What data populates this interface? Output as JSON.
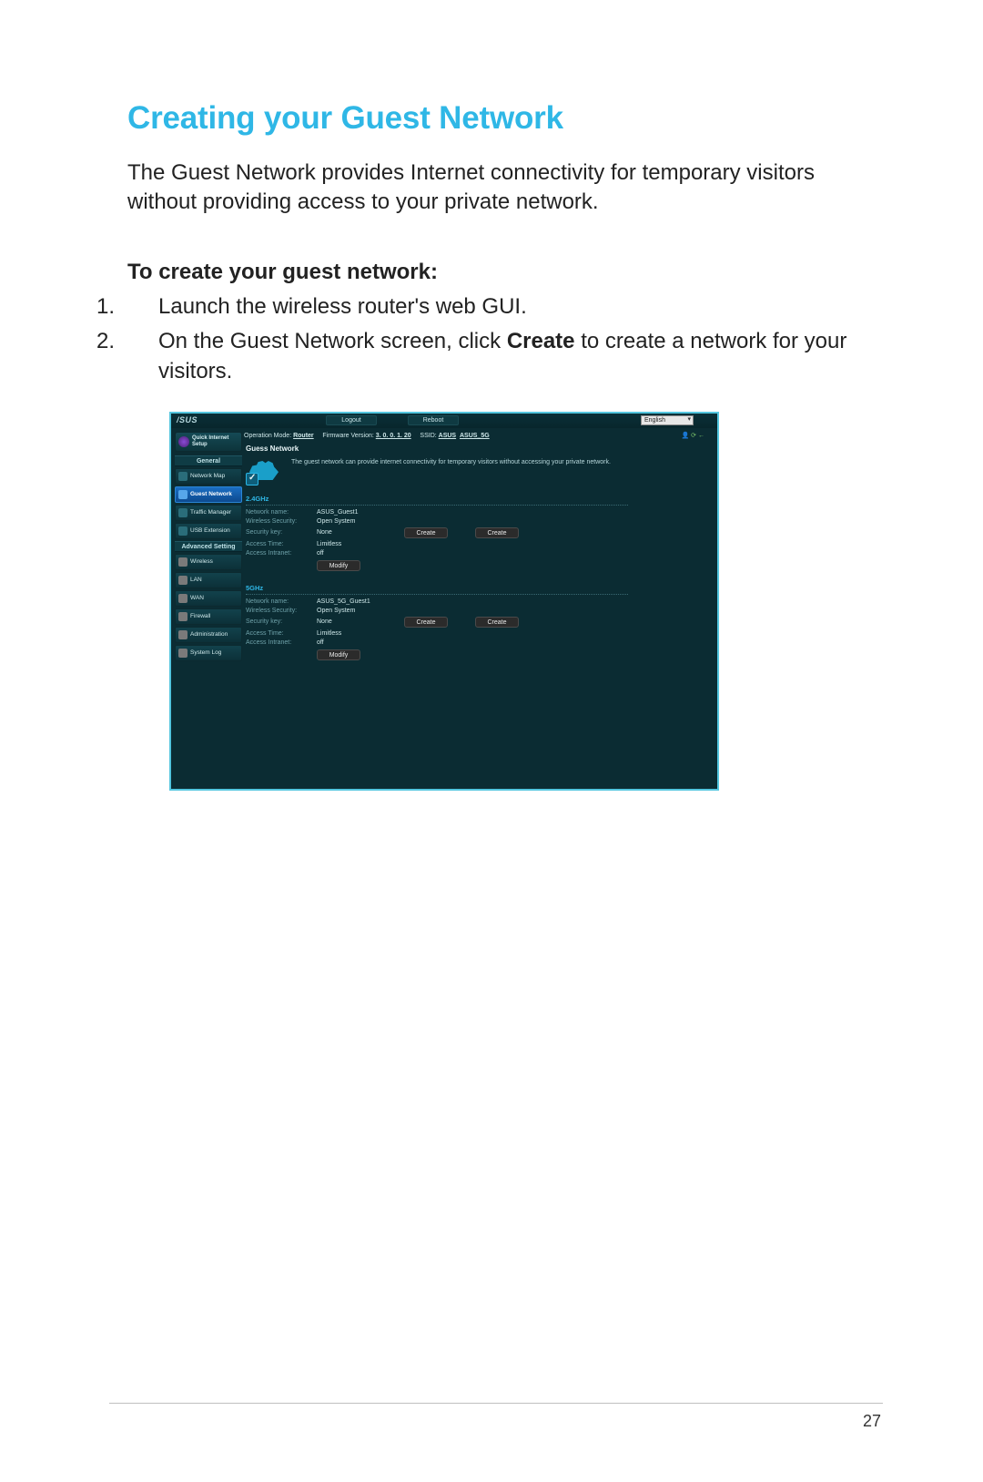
{
  "doc": {
    "title": "Creating your Guest Network",
    "intro": "The Guest Network provides Internet connectivity for temporary visitors without providing access to your private network.",
    "subhead": "To create your guest network:",
    "steps": {
      "n1": "1.",
      "s1": "Launch the wireless router's web GUI.",
      "n2": "2.",
      "s2a": "On the Guest Network screen, click ",
      "s2b": "Create",
      "s2c": " to create a network for your visitors."
    },
    "page_number": "27"
  },
  "ui": {
    "brand": "/SUS",
    "top": {
      "logout": "Logout",
      "reboot": "Reboot",
      "language": "English"
    },
    "info": {
      "op_label": "Operation Mode: ",
      "op_value": "Router",
      "fw_label": "Firmware Version: ",
      "fw_value": "3. 0. 0. 1. 20",
      "ssid_label": "SSID: ",
      "ssid1": "ASUS",
      "ssid2": "ASUS_5G"
    },
    "sidebar": {
      "qis": "Quick Internet Setup",
      "general": "General",
      "items_general": [
        "Network Map",
        "Guest Network",
        "Traffic Manager",
        "USB Extension"
      ],
      "advanced": "Advanced Setting",
      "items_adv": [
        "Wireless",
        "LAN",
        "WAN",
        "Firewall",
        "Administration",
        "System Log"
      ]
    },
    "panel": {
      "title": "Guess Network",
      "desc": "The guest network can provide internet connectivity for temporary visitors without accessing your private network.",
      "band24": "2.4GHz",
      "band5": "5GHz",
      "labels": {
        "name": "Network name:",
        "security": "Wireless Security:",
        "key": "Security key:",
        "time": "Access Time:",
        "intranet": "Access Intranet:"
      },
      "values24": {
        "name": "ASUS_Guest1",
        "security": "Open System",
        "key": "None",
        "time": "Limitless",
        "intranet": "off"
      },
      "values5": {
        "name": "ASUS_5G_Guest1",
        "security": "Open System",
        "key": "None",
        "time": "Limitless",
        "intranet": "off"
      },
      "create": "Create",
      "modify": "Modify"
    }
  }
}
